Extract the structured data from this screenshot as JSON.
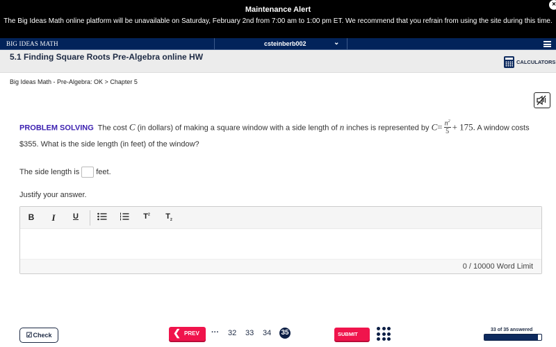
{
  "alert": {
    "title": "Maintenance Alert",
    "message": "The Big Ideas Math online platform will be unavailable on Saturday, February 2nd from 7:00 am to 1:00 pm ET. We recommend that you refrain from using the site during this time.",
    "close_icon": "×"
  },
  "navbar": {
    "brand": "BIG IDEAS MATH",
    "username": "csteinberb002",
    "user_menu_icon": "⌄",
    "menu_icon": "hamburger-menu-icon"
  },
  "assignment": {
    "title": "5.1 Finding Square Roots Pre-Algebra online HW",
    "calculators_label": "CALCULATORS"
  },
  "breadcrumb": "Big Ideas Math - Pre-Algebra: OK > Chapter 5",
  "audio": {
    "icon": "speaker-muted-icon"
  },
  "problem": {
    "label": "PROBLEM SOLVING",
    "text_1": "The cost",
    "var_C": "C",
    "text_2": "(in dollars) of making a square window with a side length of",
    "var_n": "n",
    "text_3": "inches is represented by",
    "eq_lhs": "C",
    "eq_sign": "=",
    "frac_num": "n",
    "frac_exp": "2",
    "frac_den": "5",
    "eq_rest": "+ 175.",
    "text_4": "A window costs $355. What is the side length (in feet) of the window?"
  },
  "answer": {
    "prefix": "The side length is",
    "value": "",
    "suffix": "feet."
  },
  "justify_label": "Justify your answer.",
  "editor": {
    "toolbar": {
      "bold": "B",
      "italic": "I",
      "underline": "U",
      "bullet_list": "☰",
      "numbered_list": "☰",
      "superscript": "T",
      "subscript": "T",
      "sup_mark": "2",
      "sub_mark": "2"
    },
    "content": "",
    "word_count": "0 / 10000 Word Limit"
  },
  "footer": {
    "check_label": "Check",
    "prev_label": "PREV",
    "ellipsis": "···",
    "pages": [
      "32",
      "33",
      "34"
    ],
    "current_page": "35",
    "submit_label": "SUBMIT",
    "progress_label": "33 of 35 answered",
    "answered": 33,
    "total": 35
  }
}
